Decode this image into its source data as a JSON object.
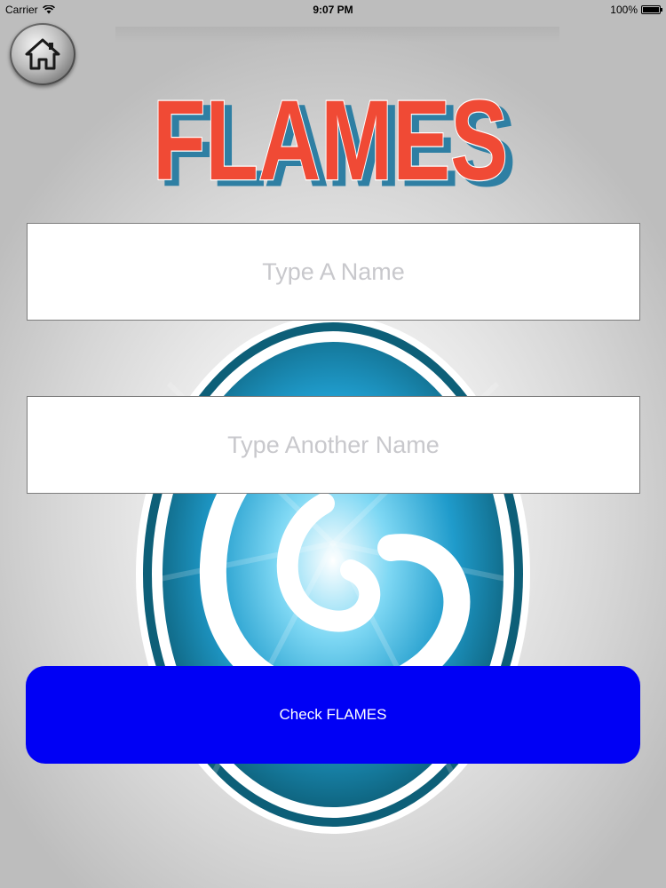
{
  "status_bar": {
    "carrier": "Carrier",
    "time": "9:07 PM",
    "battery": "100%",
    "battery_level": 1.0
  },
  "header": {
    "home_icon": "house-icon",
    "logo_text": "FLAMES"
  },
  "form": {
    "first_name_placeholder": "Type A Name",
    "first_name_value": "",
    "second_name_placeholder": "Type Another Name",
    "second_name_value": "",
    "check_label": "Check FLAMES"
  },
  "colors": {
    "logo_fill": "#f04a35",
    "logo_shadow": "#2f7fa3",
    "button": "#0000f5",
    "swirl_dark": "#0d5f78",
    "swirl_light": "#7fd8f4"
  }
}
